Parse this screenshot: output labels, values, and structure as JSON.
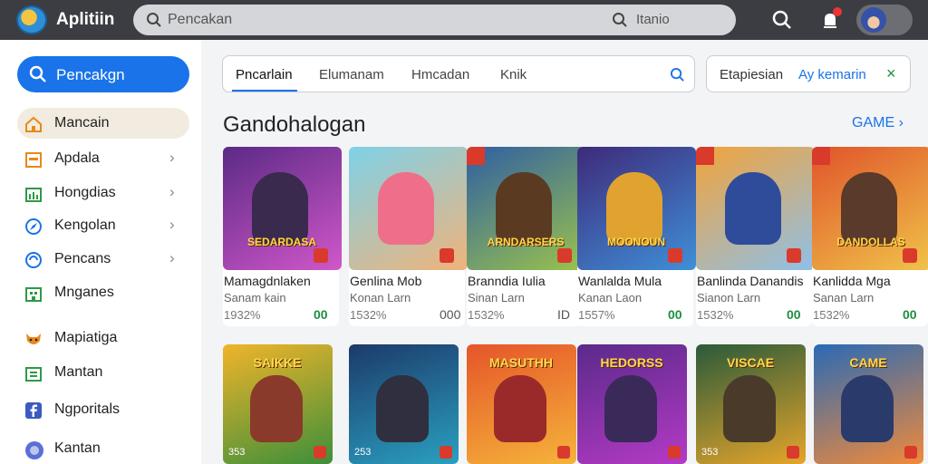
{
  "app": {
    "title": "Aplitiin"
  },
  "topbar": {
    "search_value": "Pencakan",
    "search_hint": "Itanio"
  },
  "sidebar": {
    "primary_button": "Pencakgn",
    "items": [
      {
        "label": "Mancain",
        "icon": "home-icon",
        "active": true,
        "chevron": false
      },
      {
        "label": "Apdala",
        "icon": "calendar-icon",
        "active": false,
        "chevron": true
      },
      {
        "label": "Hongdias",
        "icon": "chart-icon",
        "active": false,
        "chevron": true
      },
      {
        "label": "Kengolan",
        "icon": "compass-icon",
        "active": false,
        "chevron": true
      },
      {
        "label": "Pencans",
        "icon": "refresh-icon",
        "active": false,
        "chevron": true
      },
      {
        "label": "Mnganes",
        "icon": "building-icon",
        "active": false,
        "chevron": false
      },
      {
        "label": "Mapiatiga",
        "icon": "fox-icon",
        "active": false,
        "chevron": false
      },
      {
        "label": "Mantan",
        "icon": "bank-icon",
        "active": false,
        "chevron": false
      },
      {
        "label": "Ngporitals",
        "icon": "facebook-icon",
        "active": false,
        "chevron": false
      },
      {
        "label": "Kantan",
        "icon": "globe-icon",
        "active": false,
        "chevron": false
      }
    ]
  },
  "tabs": [
    {
      "label": "Pncarlain"
    },
    {
      "label": "Elumanam"
    },
    {
      "label": "Hmcadan"
    },
    {
      "label": "Knik"
    }
  ],
  "filter": {
    "label": "Etapiesian",
    "value": "Ay kemarin",
    "close": "×"
  },
  "section": {
    "title": "Gandohalogan",
    "link": "GAME",
    "link_chevron": "›"
  },
  "cards_row1": [
    {
      "title": "Mamagdnlaken",
      "sub": "Sanam kain",
      "meta": "1932%",
      "price": "00",
      "price_green": true,
      "banner": "SEDARDASA",
      "ribbon": false,
      "colors": {
        "bg1": "#5b2a86",
        "bg2": "#d157c9",
        "fig": "#3a2a4d"
      }
    },
    {
      "title": "Genlina Mob",
      "sub": "Konan Larn",
      "meta": "1532%",
      "price": "000",
      "price_green": false,
      "banner": "",
      "ribbon": false,
      "colors": {
        "bg1": "#7fd1e8",
        "bg2": "#f0b37a",
        "fig": "#ef6f8a"
      }
    },
    {
      "title": "Branndia Iulia",
      "sub": "Sinan Larn",
      "meta": "1532%",
      "price": "ID",
      "price_green": false,
      "banner": "ARNDARSERS",
      "ribbon": true,
      "colors": {
        "bg1": "#2f5fa3",
        "bg2": "#9bc34b",
        "fig": "#5a3a20"
      }
    },
    {
      "title": "Wanlalda Mula",
      "sub": "Kanan Laon",
      "meta": "1557%",
      "price": "00",
      "price_green": true,
      "banner": "MOONOUN",
      "ribbon": false,
      "colors": {
        "bg1": "#3e2a7a",
        "bg2": "#3f8fd8",
        "fig": "#e0a330"
      }
    },
    {
      "title": "Banlinda Danandis",
      "sub": "Sianon Larn",
      "meta": "1532%",
      "price": "00",
      "price_green": true,
      "banner": "",
      "ribbon": true,
      "colors": {
        "bg1": "#f2a33a",
        "bg2": "#8fc0e8",
        "fig": "#2f4c9a"
      }
    },
    {
      "title": "Kanlidda Mga",
      "sub": "Sanan Larn",
      "meta": "1532%",
      "price": "00",
      "price_green": true,
      "banner": "DANDOLLAS",
      "ribbon": true,
      "colors": {
        "bg1": "#e0542a",
        "bg2": "#f0c34a",
        "fig": "#5a3a2a"
      }
    }
  ],
  "cards_row2": [
    {
      "banner": "SAIKKE",
      "count": "353",
      "colors": {
        "bg1": "#f0b42a",
        "bg2": "#3c8f3a",
        "fig": "#8a3a2a"
      }
    },
    {
      "banner": "",
      "count": "253",
      "colors": {
        "bg1": "#1c3a6a",
        "bg2": "#2aa0c0",
        "fig": "#2f2f3f"
      }
    },
    {
      "banner": "MASUTHH",
      "count": "",
      "colors": {
        "bg1": "#e5552a",
        "bg2": "#f5b43a",
        "fig": "#9a2a2a"
      }
    },
    {
      "banner": "HEDORSS",
      "count": "",
      "colors": {
        "bg1": "#5a2a8a",
        "bg2": "#b53ac5",
        "fig": "#3a2a5a"
      }
    },
    {
      "banner": "VISCAE",
      "count": "353",
      "colors": {
        "bg1": "#2a5a3a",
        "bg2": "#e5a52a",
        "fig": "#4a3a2a"
      }
    },
    {
      "banner": "CAME",
      "count": "",
      "colors": {
        "bg1": "#2a6ab5",
        "bg2": "#f08a3a",
        "fig": "#2a3a6a"
      }
    }
  ],
  "accent": "#1a73e8",
  "green": "#1e8e3e"
}
